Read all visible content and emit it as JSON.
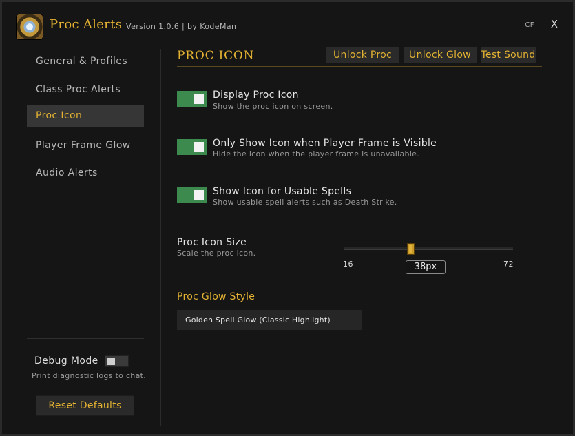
{
  "header": {
    "title": "Proc Alerts",
    "version": "Version 1.0.6  |  by KodeMan",
    "cf_label": "CF",
    "close_label": "X",
    "logo_icon": "proc-alerts-logo-icon"
  },
  "sidebar": {
    "items": [
      {
        "label": "General & Profiles",
        "active": false
      },
      {
        "label": "Class Proc Alerts",
        "active": false
      },
      {
        "label": "Proc Icon",
        "active": true
      },
      {
        "label": "Player Frame Glow",
        "active": false
      },
      {
        "label": "Audio Alerts",
        "active": false
      }
    ],
    "debug": {
      "label": "Debug Mode",
      "enabled": false,
      "description": "Print diagnostic logs to chat."
    },
    "reset_label": "Reset Defaults"
  },
  "main": {
    "section_title": "PROC ICON",
    "buttons": {
      "unlock_proc": "Unlock Proc",
      "unlock_glow": "Unlock Glow",
      "test_sound": "Test Sound"
    },
    "options": [
      {
        "title": "Display Proc Icon",
        "description": "Show the proc icon on screen.",
        "enabled": true
      },
      {
        "title": "Only Show Icon when Player Frame is Visible",
        "description": "Hide the icon when the player frame is unavailable.",
        "enabled": true
      },
      {
        "title": "Show Icon for Usable Spells",
        "description": "Show usable spell alerts such as Death Strike.",
        "enabled": true
      }
    ],
    "size": {
      "title": "Proc Icon Size",
      "description": "Scale the proc icon.",
      "min": "16",
      "max": "72",
      "value": "38px"
    },
    "glow": {
      "title": "Proc Glow Style",
      "selected": "Golden Spell Glow (Classic Highlight)"
    }
  },
  "colors": {
    "accent": "#e3b232",
    "toggle_on": "#3c8a4e",
    "background": "#151515"
  }
}
